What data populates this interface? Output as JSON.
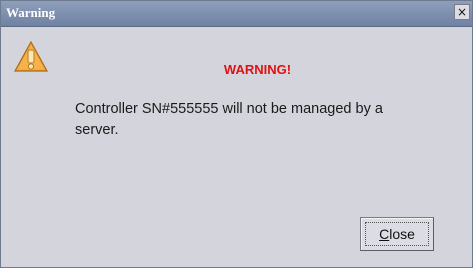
{
  "window": {
    "title": "Warning",
    "close_glyph": "×"
  },
  "dialog": {
    "icon": "warning-triangle-icon",
    "heading": "WARNING!",
    "message_line1": "Controller SN#555555 will not be managed by a",
    "message_line2": "server."
  },
  "buttons": {
    "close_mnemonic": "C",
    "close_rest": "lose"
  },
  "colors": {
    "heading": "#e21010",
    "titlebar": "#7d8fb0",
    "background": "#d4d4dc",
    "icon_fill": "#f0a030"
  }
}
